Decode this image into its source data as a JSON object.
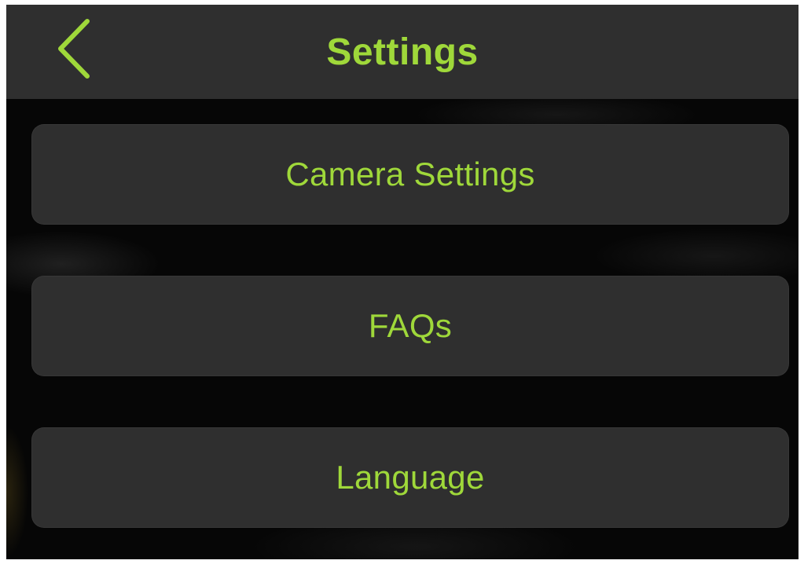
{
  "header": {
    "title": "Settings",
    "back_icon": "chevron-left-icon"
  },
  "menu": {
    "items": [
      {
        "label": "Camera Settings"
      },
      {
        "label": "FAQs"
      },
      {
        "label": "Language"
      }
    ]
  },
  "colors": {
    "accent": "#9fd83a",
    "panel": "#2f2f2f",
    "background": "#060606"
  }
}
